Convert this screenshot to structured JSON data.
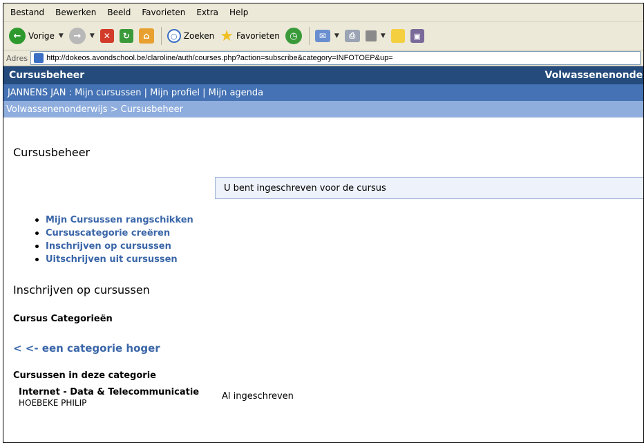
{
  "menu": [
    "Bestand",
    "Bewerken",
    "Beeld",
    "Favorieten",
    "Extra",
    "Help"
  ],
  "toolbar": {
    "back_label": "Vorige",
    "search_label": "Zoeken",
    "favorites_label": "Favorieten"
  },
  "address": {
    "label": "Adres",
    "url": "http://dokeos.avondschool.be/claroline/auth/courses.php?action=subscribe&category=INFOTOEP&up="
  },
  "header": {
    "title": "Cursusbeheer",
    "org": "Volwassenenonder"
  },
  "userbar": {
    "text": "JANNENS JAN : Mijn cursussen | Mijn profiel | Mijn agenda"
  },
  "breadcrumb": {
    "text": "Volwassenenonderwijs > Cursusbeheer"
  },
  "main": {
    "heading": "Cursusbeheer",
    "message": "U bent ingeschreven voor de cursus",
    "links": [
      "Mijn Cursussen rangschikken",
      "Cursuscategorie creëren",
      "Inschrijven op cursussen",
      "Uitschrijven uit cursussen"
    ],
    "subscribe_heading": "Inschrijven op cursussen",
    "categories_heading": "Cursus Categorieën",
    "up_link": "< <- een categorie hoger",
    "courses_heading": "Cursussen in deze categorie",
    "course": {
      "title": "Internet - Data & Telecommunicatie",
      "teacher": "HOEBEKE PHILIP",
      "status": "Al ingeschreven"
    }
  },
  "colors": {
    "header_bg": "#244b7c",
    "userbar_bg": "#4472b4",
    "crumb_bg": "#8faede",
    "link": "#3a66a8"
  }
}
